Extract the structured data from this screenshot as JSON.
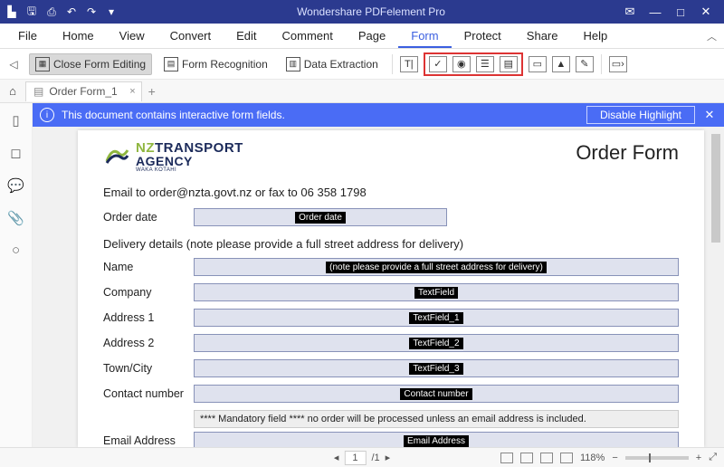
{
  "titlebar": {
    "app_title": "Wondershare PDFelement Pro"
  },
  "menu": {
    "items": [
      "File",
      "Home",
      "View",
      "Convert",
      "Edit",
      "Comment",
      "Page",
      "Form",
      "Protect",
      "Share",
      "Help"
    ],
    "active": "Form"
  },
  "ribbon": {
    "close_form_editing": "Close Form Editing",
    "form_recognition": "Form Recognition",
    "data_extraction": "Data Extraction"
  },
  "tabs": {
    "doc_name": "Order Form_1"
  },
  "banner": {
    "message": "This document contains interactive form fields.",
    "disable": "Disable Highlight"
  },
  "document": {
    "logo": {
      "line1_nz": "NZ",
      "line1_rest": "TRANSPORT",
      "line2": "AGENCY",
      "line3": "WAKA KOTAHI"
    },
    "title": "Order Form",
    "intro": "Email to order@nzta.govt.nz or fax to 06 358 1798",
    "rows": {
      "order_date_label": "Order date",
      "order_date_tag": "Order date",
      "section_head": "Delivery details (note please provide a full street address for delivery)",
      "name_label": "Name",
      "name_tag": "(note please provide a full street address for delivery)",
      "company_label": "Company",
      "company_tag": "TextField",
      "addr1_label": "Address 1",
      "addr1_tag": "TextField_1",
      "addr2_label": "Address 2",
      "addr2_tag": "TextField_2",
      "town_label": "Town/City",
      "town_tag": "TextField_3",
      "contact_label": "Contact number",
      "contact_tag": "Contact number",
      "mandatory_note": "**** Mandatory field **** no order will be processed unless an email address is included.",
      "email_label": "Email Address",
      "email_tag": "Email Address"
    }
  },
  "status": {
    "page_current": "1",
    "page_sep": "/1",
    "zoom": "118%"
  }
}
